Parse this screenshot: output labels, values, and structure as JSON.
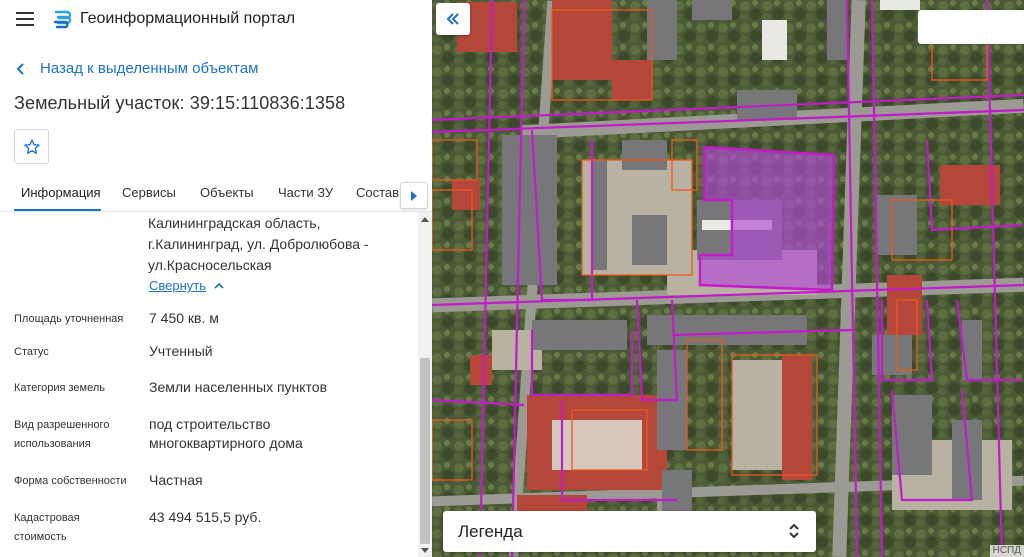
{
  "header": {
    "app_title": "Геоинформационный портал"
  },
  "back_link": "Назад к выделенным объектам",
  "object_title": "Земельный участок: 39:15:110836:1358",
  "tabs": [
    {
      "label": "Информация",
      "active": true
    },
    {
      "label": "Сервисы"
    },
    {
      "label": "Объекты"
    },
    {
      "label": "Части ЗУ"
    },
    {
      "label": "Состав"
    }
  ],
  "address": {
    "lines": [
      "Калининградская область,",
      "г.Калининград, ул. Добролюбова -",
      "ул.Красносельская"
    ],
    "collapse_label": "Свернуть"
  },
  "properties": [
    {
      "label": "Площадь уточненная",
      "value": "7 450 кв. м"
    },
    {
      "label": "Статус",
      "value": "Учтенный"
    },
    {
      "label": "Категория земель",
      "value": "Земли населенных пунктов"
    },
    {
      "label_lines": [
        "Вид разрешенного",
        "использования"
      ],
      "value_lines": [
        "под строительство",
        "многоквартирного дома"
      ]
    },
    {
      "label": "Форма собственности",
      "value": "Частная"
    },
    {
      "label_lines": [
        "Кадастровая",
        "стоимость"
      ],
      "value": "43 494 515,5 руб."
    }
  ],
  "map": {
    "legend_label": "Легенда",
    "attribution": "НСПД"
  },
  "colors": {
    "accent": "#1a73c9",
    "parcel_border_magenta": "#c21bc9",
    "parcel_border_orange": "#e85a1e",
    "selected_parcel_fill": "#b44ad8"
  }
}
